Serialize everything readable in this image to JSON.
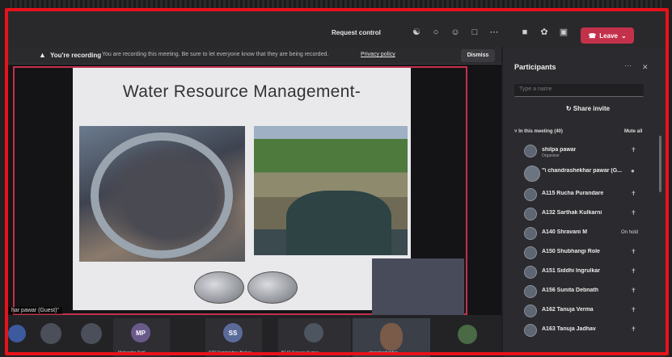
{
  "topbar": {
    "request_control": "Request control",
    "leave_label": "Leave"
  },
  "recording_banner": {
    "title": "You're recording",
    "message": "You are recording this meeting. Be sure to let everyone know that they are being recorded.",
    "privacy_link": "Privacy policy",
    "dismiss_label": "Dismiss"
  },
  "slide": {
    "title": "Water Resource Management-"
  },
  "stage": {
    "presenter_label": "har pawar (Guest)\""
  },
  "strip": {
    "tiles": [
      {
        "initials": "MP",
        "name": "Mahendra Patil"
      },
      {
        "initials": "SS",
        "name": "S09 Ramkrishna Borkar"
      },
      {
        "initials": "",
        "name": "B147 Sanvee Kumar"
      },
      {
        "initials": "",
        "name": "chandrashekhar"
      }
    ]
  },
  "participants": {
    "title": "Participants",
    "search_placeholder": "Type a name",
    "share_invite": "Share invite",
    "section_label": "In this meeting (40)",
    "mute_all": "Mute all",
    "people": [
      {
        "name": "shilpa pawar",
        "role": "Organizer",
        "status": ""
      },
      {
        "name": "\"\\ chandrashekhar pawar (G...",
        "role": "",
        "status": ""
      },
      {
        "name": "A115 Rucha Purandare",
        "role": "",
        "status": ""
      },
      {
        "name": "A132 Sarthak Kulkarni",
        "role": "",
        "status": ""
      },
      {
        "name": "A140 Shravani M",
        "role": "",
        "status": "On hold"
      },
      {
        "name": "A150 Shubhangi Role",
        "role": "",
        "status": ""
      },
      {
        "name": "A151 Siddhi Ingrulkar",
        "role": "",
        "status": ""
      },
      {
        "name": "A156 Sunita Debnath",
        "role": "",
        "status": ""
      },
      {
        "name": "A162 Tanuja Verma",
        "role": "",
        "status": ""
      },
      {
        "name": "A163 Tanuja Jadhav",
        "role": "",
        "status": ""
      }
    ]
  },
  "colors": {
    "border": "#e8121a",
    "leave": "#c4314b",
    "panel": "#2b2b2f"
  }
}
